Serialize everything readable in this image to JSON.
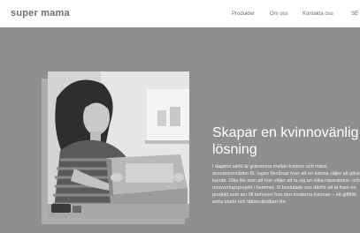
{
  "header": {
    "logo": "super mama",
    "nav": {
      "produkter": "Produkter",
      "om_oss": "Om oss",
      "kontakta_oss": "Kontakta oss",
      "language": "SE"
    }
  },
  "hero": {
    "headline": "Skapar en kvinnovänlig lösning",
    "body": "I dagens värld är gränserna mellan kvinnor och mäns ansvarsområden få. Ingen förvånas över att en kvinna väljer att göra karriär. Ulka lite som att hon väljer att ta sig an olika reparations- och renoveringsprojekt i hemmet. Vi beslutade oss därför att ta fram en produkt som ser till behoven hos den moderna kvinnan – ett giftfritt, extra starkt och lättanvändbart lim.",
    "image_alt": "woman-working-on-wooden-drawer"
  },
  "colors": {
    "background": "#8f8f8f",
    "header_bg": "#ffffff",
    "text_light": "#ffffff",
    "nav_text": "#6b6b6b"
  }
}
